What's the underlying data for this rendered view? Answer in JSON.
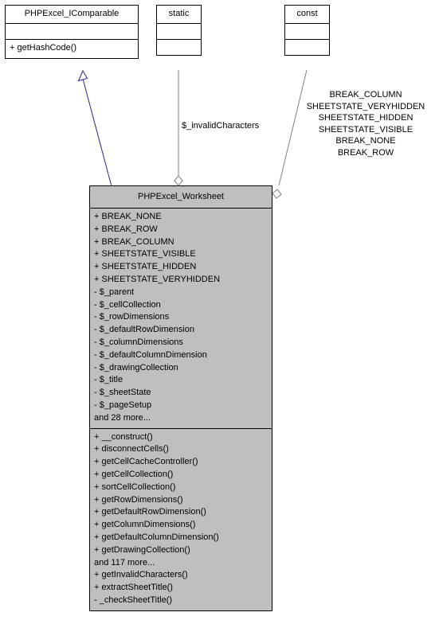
{
  "diagram": {
    "nodes": [
      {
        "id": "phpexcel-icomparable",
        "title": "PHPExcel_IComparable",
        "members_compartment1": [],
        "members_compartment2": [
          "+ getHashCode()"
        ]
      },
      {
        "id": "static",
        "title": "static",
        "members_compartment1": [],
        "members_compartment2": []
      },
      {
        "id": "const",
        "title": "const",
        "members_compartment1": [],
        "members_compartment2": []
      },
      {
        "id": "phpexcel-worksheet",
        "title": "PHPExcel_Worksheet",
        "attributes": [
          "+ BREAK_NONE",
          "+ BREAK_ROW",
          "+ BREAK_COLUMN",
          "+ SHEETSTATE_VISIBLE",
          "+ SHEETSTATE_HIDDEN",
          "+ SHEETSTATE_VERYHIDDEN",
          "- $_parent",
          "- $_cellCollection",
          "- $_rowDimensions",
          "- $_defaultRowDimension",
          "- $_columnDimensions",
          "- $_defaultColumnDimension",
          "- $_drawingCollection",
          "- $_title",
          "- $_sheetState",
          "- $_pageSetup",
          "and 28 more..."
        ],
        "operations": [
          "+ __construct()",
          "+ disconnectCells()",
          "+ getCellCacheController()",
          "+ getCellCollection()",
          "+ sortCellCollection()",
          "+ getRowDimensions()",
          "+ getDefaultRowDimension()",
          "+ getColumnDimensions()",
          "+ getDefaultColumnDimension()",
          "+ getDrawingCollection()",
          "and 117 more...",
          "+ getInvalidCharacters()",
          "+ extractSheetTitle()",
          "- _checkSheetTitle()"
        ]
      }
    ],
    "edge_labels": {
      "static_label": "$_invalidCharacters",
      "const_labels": [
        "BREAK_COLUMN",
        "SHEETSTATE_VERYHIDDEN",
        "SHEETSTATE_HIDDEN",
        "SHEETSTATE_VISIBLE",
        "BREAK_NONE",
        "BREAK_ROW"
      ]
    },
    "colors": {
      "main_node_fill": "#bfbfbf",
      "node_fill": "#ffffff",
      "border": "#000000",
      "inheritance_edge": "#29298c",
      "association_edge": "#808080"
    }
  }
}
